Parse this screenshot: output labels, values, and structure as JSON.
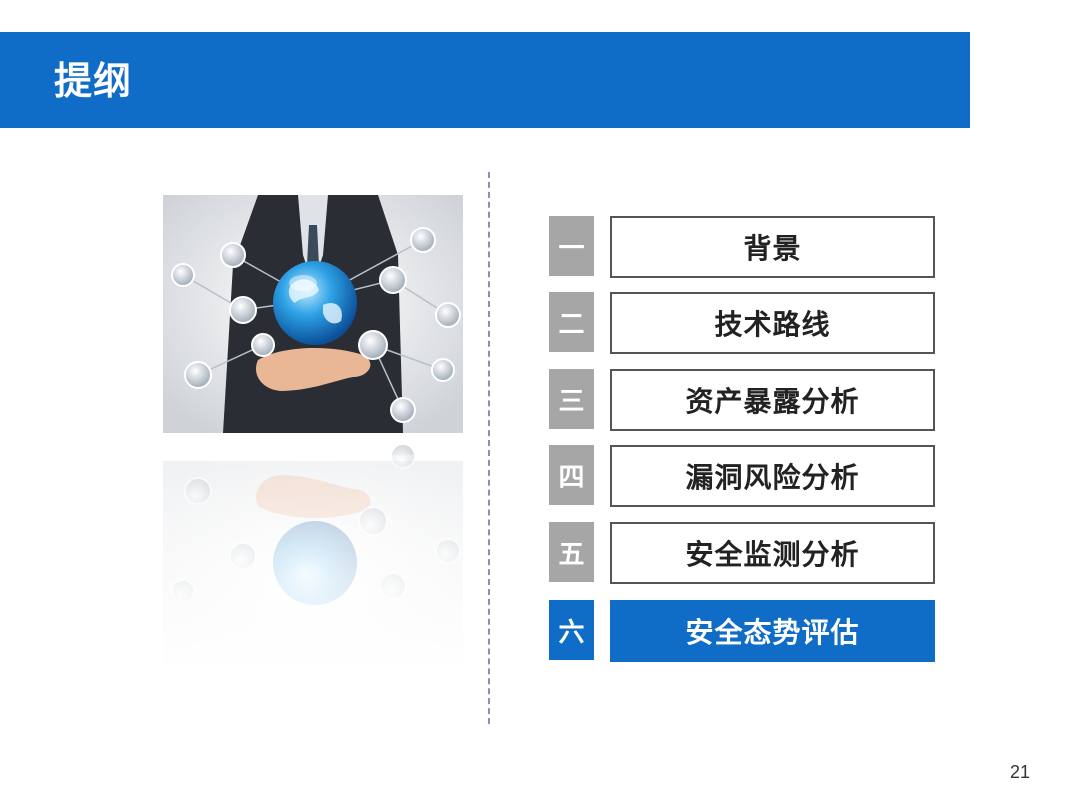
{
  "header": {
    "title": "提纲"
  },
  "outline": {
    "items": [
      {
        "number": "一",
        "label": "背景",
        "active": false
      },
      {
        "number": "二",
        "label": "技术路线",
        "active": false
      },
      {
        "number": "三",
        "label": "资产暴露分析",
        "active": false
      },
      {
        "number": "四",
        "label": "漏洞风险分析",
        "active": false
      },
      {
        "number": "五",
        "label": "安全监测分析",
        "active": false
      },
      {
        "number": "六",
        "label": "安全态势评估",
        "active": true
      }
    ]
  },
  "footer": {
    "page_number": "21"
  },
  "colors": {
    "accent": "#0f6cc7",
    "inactive_number_bg": "#a6a6a6",
    "border": "#555555"
  }
}
